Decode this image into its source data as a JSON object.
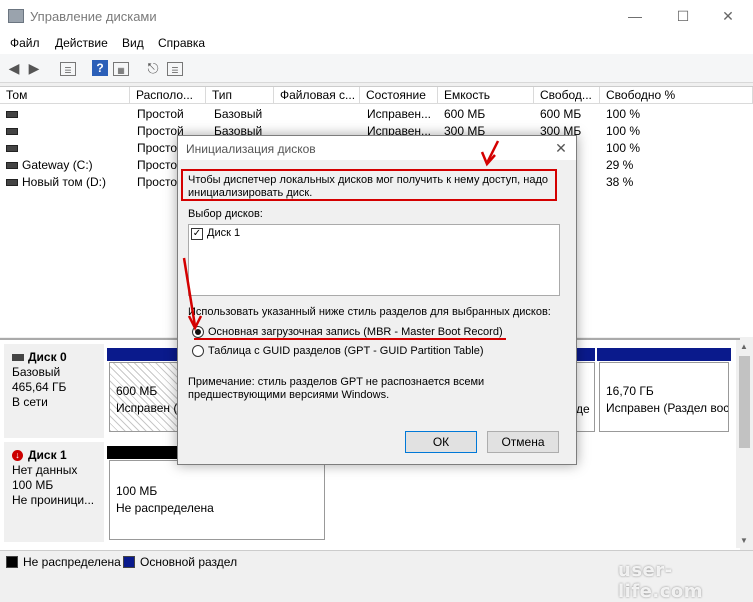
{
  "window": {
    "title": "Управление дисками",
    "minimize": "—",
    "maximize": "☐",
    "close": "✕"
  },
  "menu": [
    "Файл",
    "Действие",
    "Вид",
    "Справка"
  ],
  "toolbar_icons": [
    "back-arrow-icon",
    "forward-arrow-icon",
    "properties-icon",
    "help-icon",
    "panel-icon",
    "connect-icon",
    "list-view-icon"
  ],
  "volumes": {
    "columns": [
      "Том",
      "Располо...",
      "Тип",
      "Файловая с...",
      "Состояние",
      "Емкость",
      "Свобод...",
      "Свободно %"
    ],
    "rows": [
      [
        "",
        "Простой",
        "Базовый",
        "",
        "Исправен...",
        "600 МБ",
        "600 МБ",
        "100 %"
      ],
      [
        "",
        "Простой",
        "Базовый",
        "",
        "Исправен...",
        "300 МБ",
        "300 МБ",
        "100 %"
      ],
      [
        "",
        "Простой",
        "",
        "",
        "",
        "",
        "",
        "100 %"
      ],
      [
        "Gateway (C:)",
        "Просто",
        "",
        "",
        "",
        "",
        "",
        "29 %"
      ],
      [
        "Новый том (D:)",
        "Просто",
        "",
        "",
        "",
        "",
        "",
        "38 %"
      ]
    ]
  },
  "disks": [
    {
      "name": "Диск 0",
      "type": "Базовый",
      "size": "465,64 ГБ",
      "status": "В сети",
      "part1_size": "600 МБ",
      "part1_status": "Исправен (",
      "part2_fragment": "де",
      "part3_size": "16,70 ГБ",
      "part3_status": "Исправен (Раздел вос"
    },
    {
      "name": "Диск 1",
      "type": "Нет данных",
      "size": "100 МБ",
      "status": "Не проиници...",
      "part1_size": "100 МБ",
      "part1_status": "Не распределена"
    }
  ],
  "legend": {
    "unallocated": "Не распределена",
    "primary": "Основной раздел"
  },
  "dialog": {
    "title": "Инициализация дисков",
    "message": "Чтобы диспетчер локальных дисков мог получить к нему доступ, надо инициализировать диск.",
    "select_label": "Выбор дисков:",
    "disk_item": "Диск 1",
    "style_label": "Использовать указанный ниже стиль разделов для выбранных дисков:",
    "option_mbr": "Основная загрузочная запись (MBR - Master Boot Record)",
    "option_gpt": "Таблица с GUID разделов (GPT - GUID Partition Table)",
    "note": "Примечание: стиль разделов GPT не распознается всеми предшествующими версиями Windows.",
    "ok": "ОК",
    "cancel": "Отмена",
    "mbr_selected": true,
    "disk_checked": true
  },
  "watermark": "user-life.com",
  "colors": {
    "primary_partition": "#0a1a8c",
    "unallocated": "#000000",
    "annotation": "#d40000"
  }
}
